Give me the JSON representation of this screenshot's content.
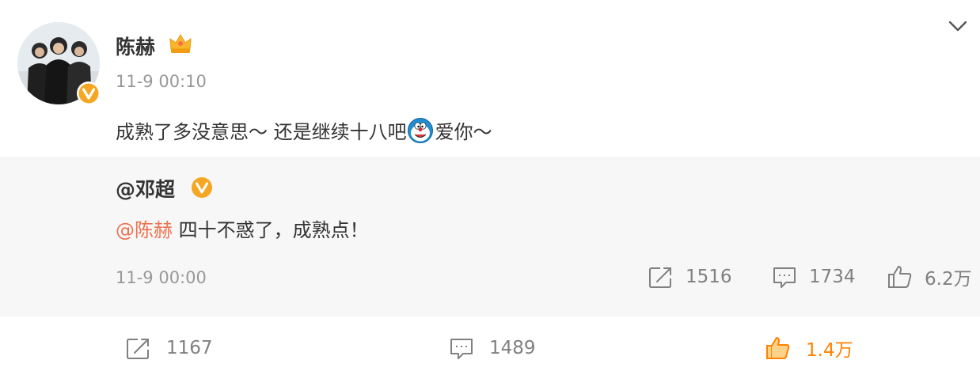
{
  "post": {
    "author": "陈赫",
    "time": "11-9 00:10",
    "text_before_emoji": "成熟了多没意思～ 还是继续十八吧",
    "text_after_emoji": " 爱你～"
  },
  "repost": {
    "author": "@邓超",
    "mention": "@陈赫",
    "text": " 四十不惑了，成熟点！",
    "time": "11-9 00:00",
    "reposts": "1516",
    "comments": "1734",
    "likes": "6.2万"
  },
  "footer": {
    "reposts": "1167",
    "comments": "1489",
    "likes": "1.4万"
  },
  "colors": {
    "mention": "#eb7350",
    "liked": "#ff8200",
    "verified": "#f5a623"
  },
  "icons": [
    "avatar",
    "verified-badge-icon",
    "crown-icon",
    "chevron-down-icon",
    "doraemon-emoji-icon",
    "repost-icon",
    "comment-icon",
    "like-icon"
  ]
}
